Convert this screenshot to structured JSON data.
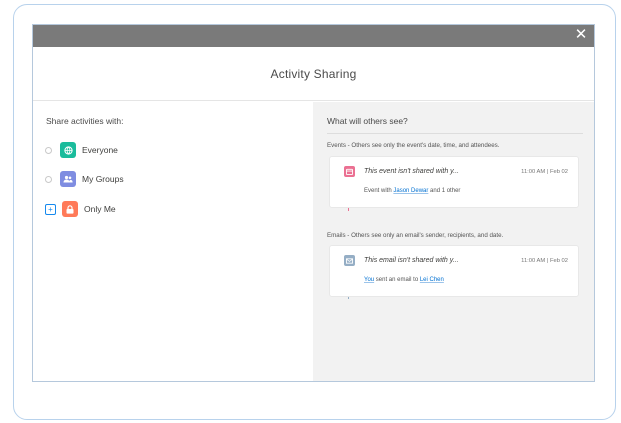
{
  "modal": {
    "close_icon": "close-icon",
    "title": "Activity Sharing"
  },
  "left": {
    "share_label": "Share activities with:",
    "options": [
      {
        "label": "Everyone",
        "icon": "globe-icon",
        "color": "#1abc9c",
        "checked": false
      },
      {
        "label": "My Groups",
        "icon": "group-icon",
        "color": "#7f8de1",
        "checked": false
      },
      {
        "label": "Only Me",
        "icon": "lock-icon",
        "color": "#ff7a59",
        "checked": true
      }
    ]
  },
  "right": {
    "title": "What will others see?",
    "events": {
      "label": "Events - Others see only the event's date, time, and attendees.",
      "icon": "calendar-icon",
      "color": "#eb7092",
      "item_title": "This event isn't shared with y...",
      "item_meta": "11:00 AM | Feb 02",
      "sub_prefix": "Event with ",
      "sub_link": "Jason Dewar",
      "sub_suffix": " and 1 other"
    },
    "emails": {
      "label": "Emails - Others see only an email's sender, recipients, and date.",
      "icon": "email-icon",
      "color": "#95aec5",
      "item_title": "This email isn't shared with y...",
      "item_meta": "11:00 AM | Feb 02",
      "sub_link1": "You",
      "sub_middle": " sent an email to ",
      "sub_link2": "Lei Chen"
    }
  },
  "colors": {
    "accent": "#1589ee",
    "topbar": "#7a7a7a",
    "right_panel_bg": "#f2f2f2"
  }
}
